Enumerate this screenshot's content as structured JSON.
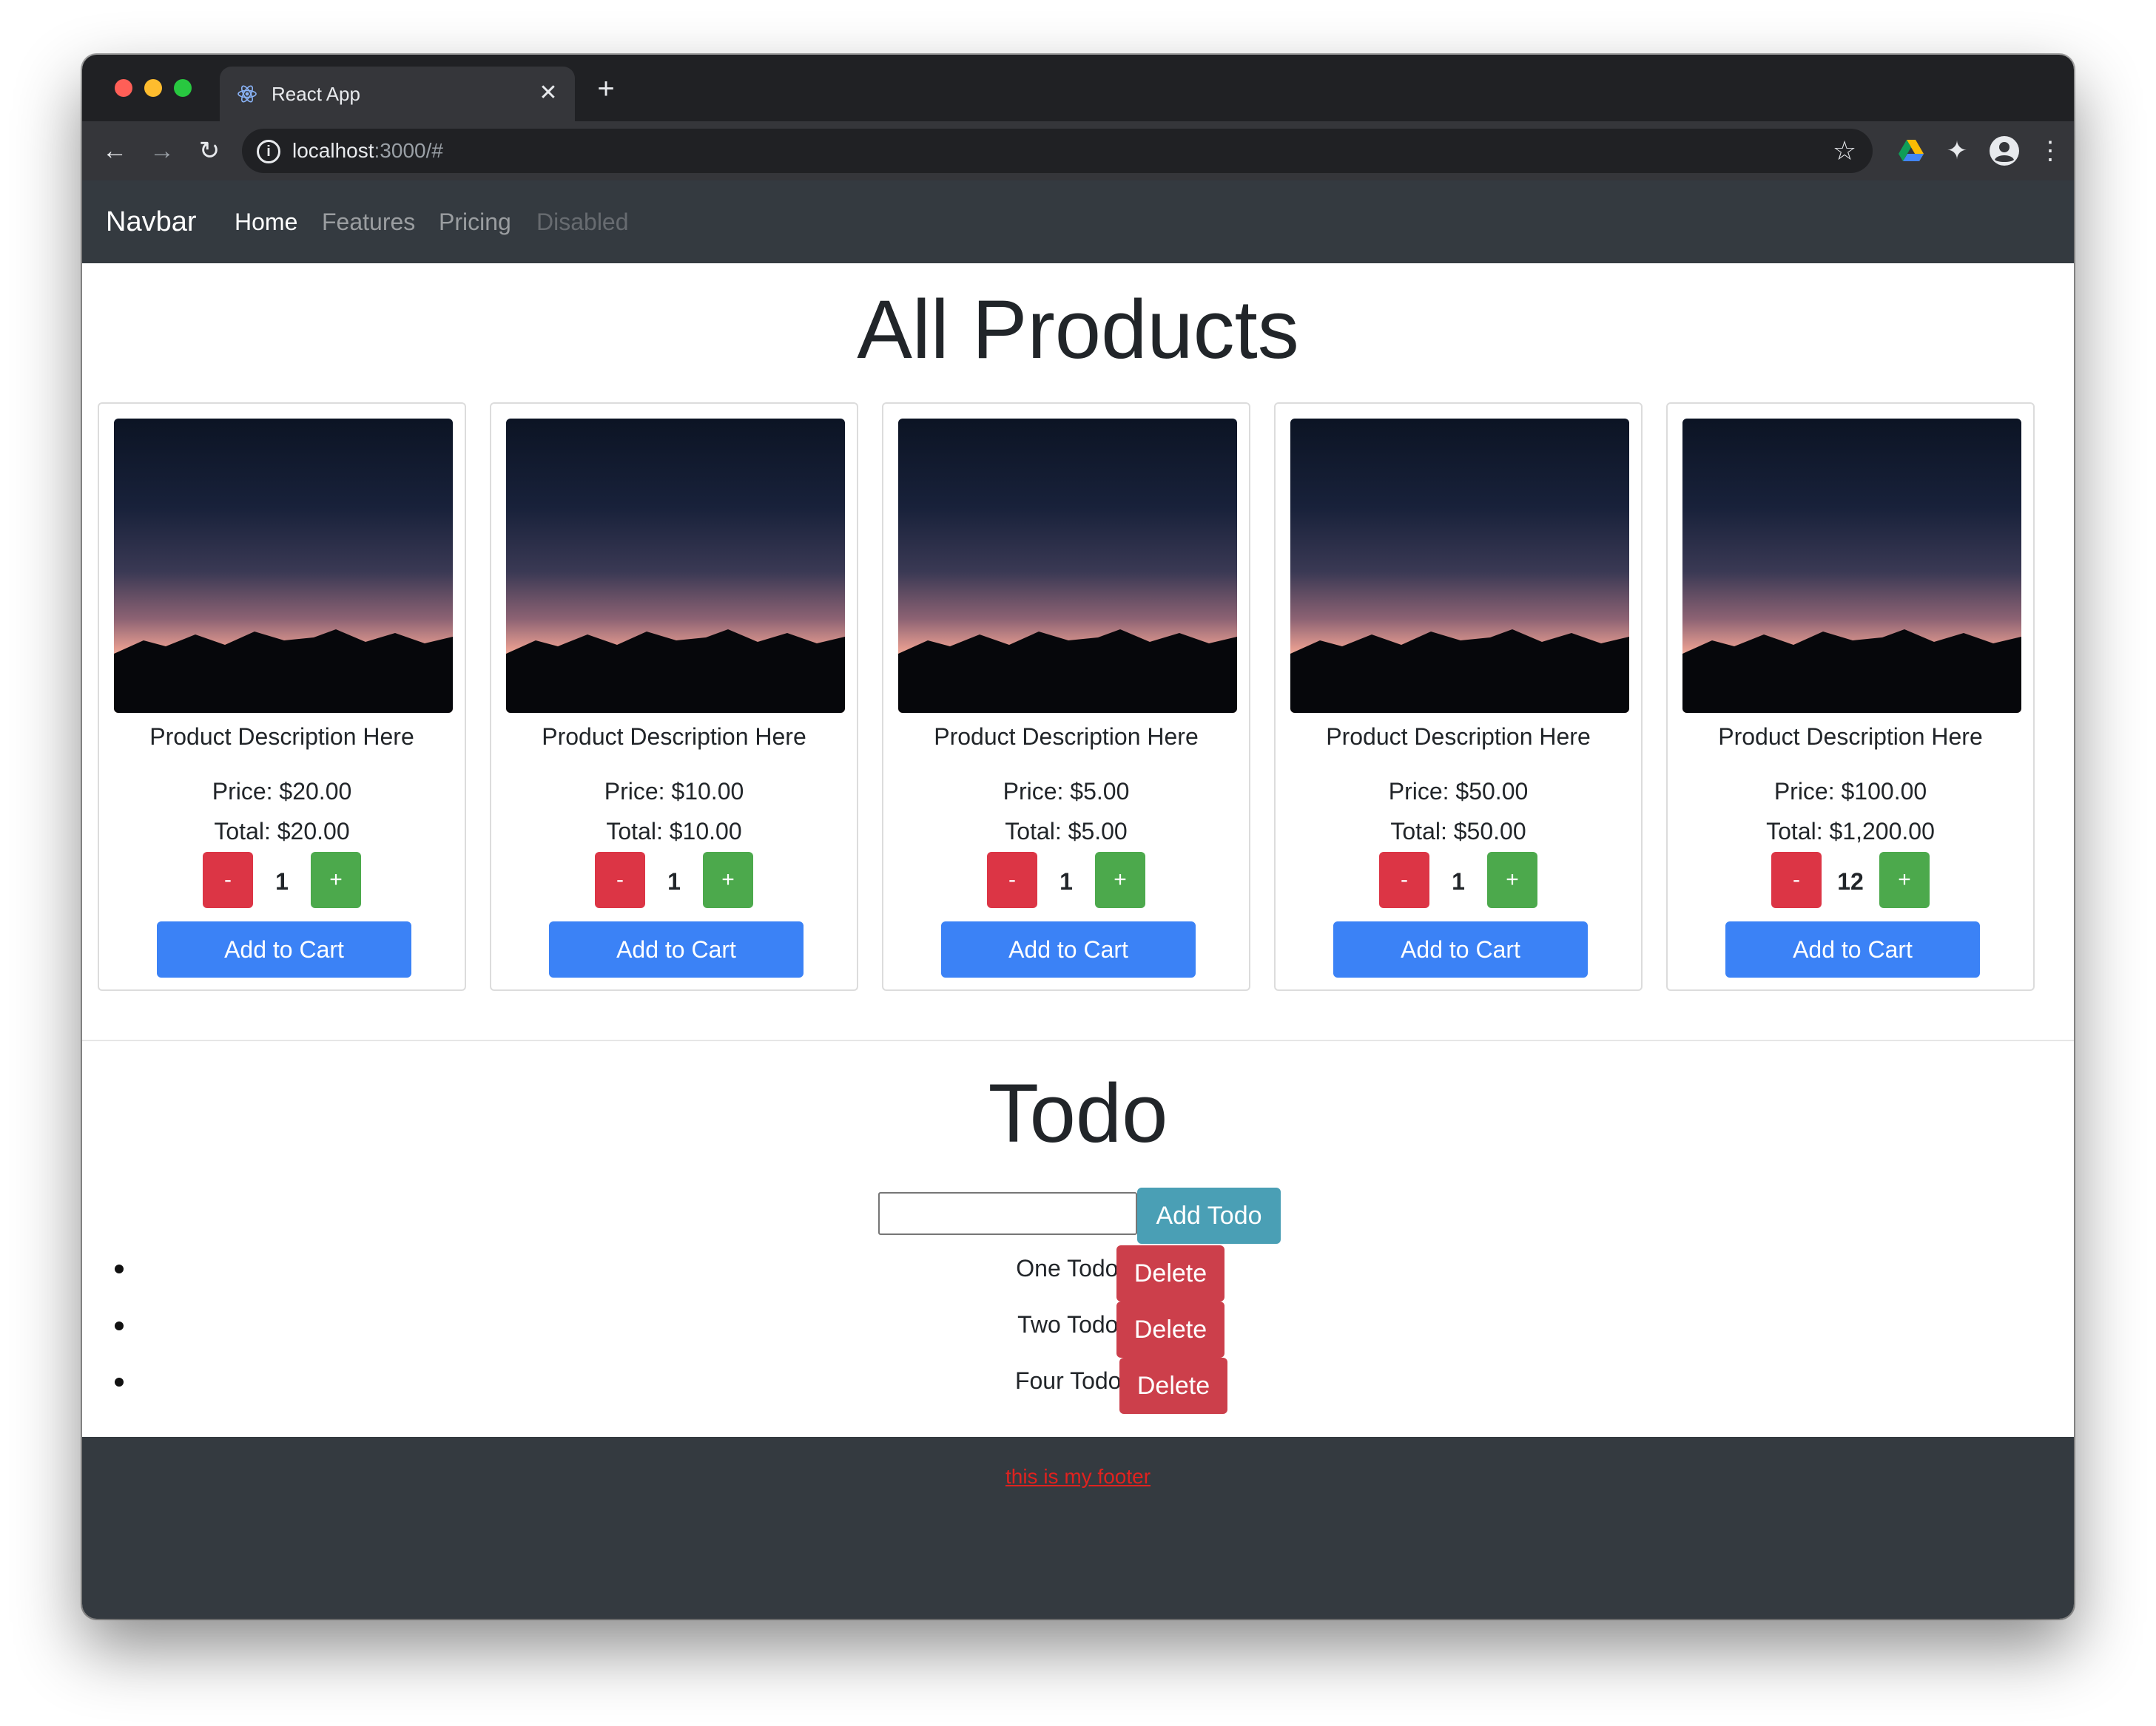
{
  "browser": {
    "tab_title": "React App",
    "close_glyph": "✕",
    "new_tab_glyph": "+",
    "url_host": "localhost",
    "url_rest": ":3000/#",
    "icons": [
      "react-logo-icon",
      "close-icon",
      "plus-icon",
      "back-arrow-icon",
      "forward-arrow-icon",
      "reload-icon",
      "info-icon",
      "star-icon",
      "google-drive-icon",
      "puzzle-icon",
      "account-icon",
      "kebab-menu-icon"
    ]
  },
  "navbar": {
    "brand": "Navbar",
    "links": [
      {
        "label": "Home",
        "state": "active"
      },
      {
        "label": "Features",
        "state": "normal"
      },
      {
        "label": "Pricing",
        "state": "normal"
      },
      {
        "label": "Disabled",
        "state": "disabled"
      }
    ]
  },
  "products": {
    "title": "All Products",
    "add_to_cart_label": "Add to Cart",
    "minus_label": "-",
    "plus_label": "+",
    "items": [
      {
        "description": "Product Description Here",
        "price": "Price: $20.00",
        "total": "Total: $20.00",
        "quantity": "1"
      },
      {
        "description": "Product Description Here",
        "price": "Price: $10.00",
        "total": "Total: $10.00",
        "quantity": "1"
      },
      {
        "description": "Product Description Here",
        "price": "Price: $5.00",
        "total": "Total: $5.00",
        "quantity": "1"
      },
      {
        "description": "Product Description Here",
        "price": "Price: $50.00",
        "total": "Total: $50.00",
        "quantity": "1"
      },
      {
        "description": "Product Description Here",
        "price": "Price: $100.00",
        "total": "Total: $1,200.00",
        "quantity": "12"
      }
    ]
  },
  "todo": {
    "title": "Todo",
    "input_value": "",
    "add_label": "Add Todo",
    "delete_label": "Delete",
    "items": [
      "One Todo -",
      "Two Todo -",
      "Four Todo -"
    ]
  },
  "footer": {
    "link_text": "this is my footer"
  },
  "colors": {
    "navbar_bg": "#343a40",
    "danger": "#dc3545",
    "success": "#4ca94c",
    "primary": "#3b82f6",
    "info": "#4a9fb5",
    "footer_link": "#e0221f"
  }
}
